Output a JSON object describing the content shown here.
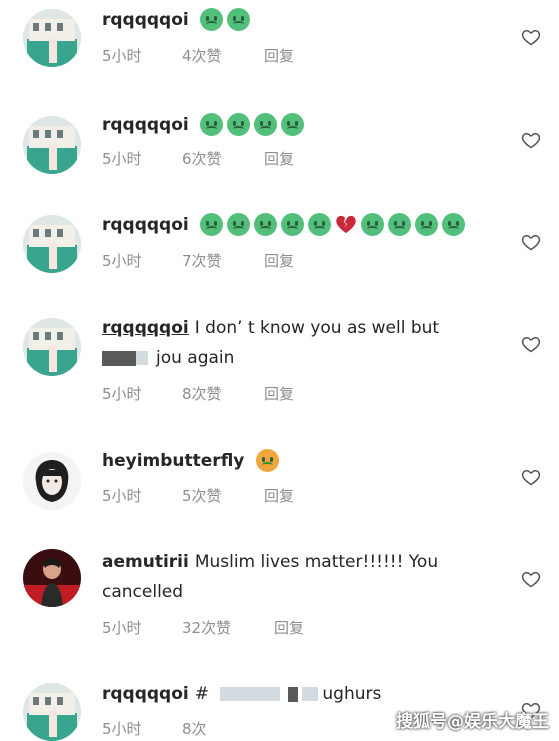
{
  "comments": [
    {
      "username": "rqqqqqoi",
      "text": "",
      "emojis": [
        "sick",
        "sick"
      ],
      "time": "5小时",
      "likes": "4次赞",
      "reply": "回复"
    },
    {
      "username": "rqqqqqoi",
      "text": "",
      "emojis": [
        "sick",
        "sick",
        "sick",
        "sick"
      ],
      "time": "5小时",
      "likes": "6次赞",
      "reply": "回复"
    },
    {
      "username": "rqqqqqoi",
      "text": "",
      "emojis": [
        "sick",
        "sick",
        "sick",
        "sick",
        "sick",
        "broken-heart",
        "sick",
        "sick",
        "sick",
        "sick"
      ],
      "time": "5小时",
      "likes": "7次赞",
      "reply": "回复"
    },
    {
      "username": "rqqqqqoi",
      "text": "I don’ t know you as well but",
      "text2": "jou again",
      "time": "5小时",
      "likes": "8次赞",
      "reply": "回复"
    },
    {
      "username": "heyimbutterfly",
      "text": "",
      "emojis": [
        "vomit"
      ],
      "time": "5小时",
      "likes": "5次赞",
      "reply": "回复"
    },
    {
      "username": "aemutirii",
      "text": "Muslim lives matter!!!!!! You",
      "text2": "cancelled",
      "time": "5小时",
      "likes": "32次赞",
      "reply": "回复"
    },
    {
      "username": "rqqqqqoi",
      "text": "#",
      "text_end": "ughurs",
      "time": "5小时",
      "likes": "8次",
      "reply": ""
    }
  ],
  "watermark": "搜狐号@娱乐大魔王",
  "icons": {
    "like": "heart-outline-icon"
  },
  "colors": {
    "meta": "#8e8e8e",
    "text": "#262626",
    "emoji": "#52c07a"
  }
}
